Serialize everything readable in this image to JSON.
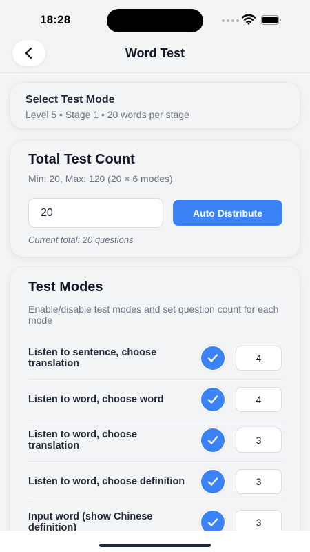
{
  "status_bar": {
    "time": "18:28",
    "icons": [
      "signal-dots-icon",
      "wifi-icon",
      "battery-icon"
    ]
  },
  "nav": {
    "back_icon": "chevron-left-icon",
    "title": "Word Test"
  },
  "select_mode": {
    "title": "Select Test Mode",
    "subtitle": "Level 5 • Stage 1 • 20 words per stage"
  },
  "test_count": {
    "title": "Total Test Count",
    "subtitle": "Min: 20, Max: 120 (20 × 6 modes)",
    "input_value": "20",
    "button_label": "Auto Distribute",
    "current_total": "Current total: 20 questions"
  },
  "test_modes": {
    "title": "Test Modes",
    "subtitle": "Enable/disable test modes and set question count for each mode",
    "items": [
      {
        "label": "Listen to sentence, choose translation",
        "enabled": true,
        "count": "4"
      },
      {
        "label": "Listen to word, choose word",
        "enabled": true,
        "count": "4"
      },
      {
        "label": "Listen to word, choose translation",
        "enabled": true,
        "count": "3"
      },
      {
        "label": "Listen to word, choose definition",
        "enabled": true,
        "count": "3"
      },
      {
        "label": "Input word (show Chinese definition)",
        "enabled": true,
        "count": "3"
      }
    ]
  },
  "colors": {
    "accent": "#3b82f6",
    "background": "#f3f4f6",
    "text_primary": "#111827",
    "text_secondary": "#6b7280"
  }
}
